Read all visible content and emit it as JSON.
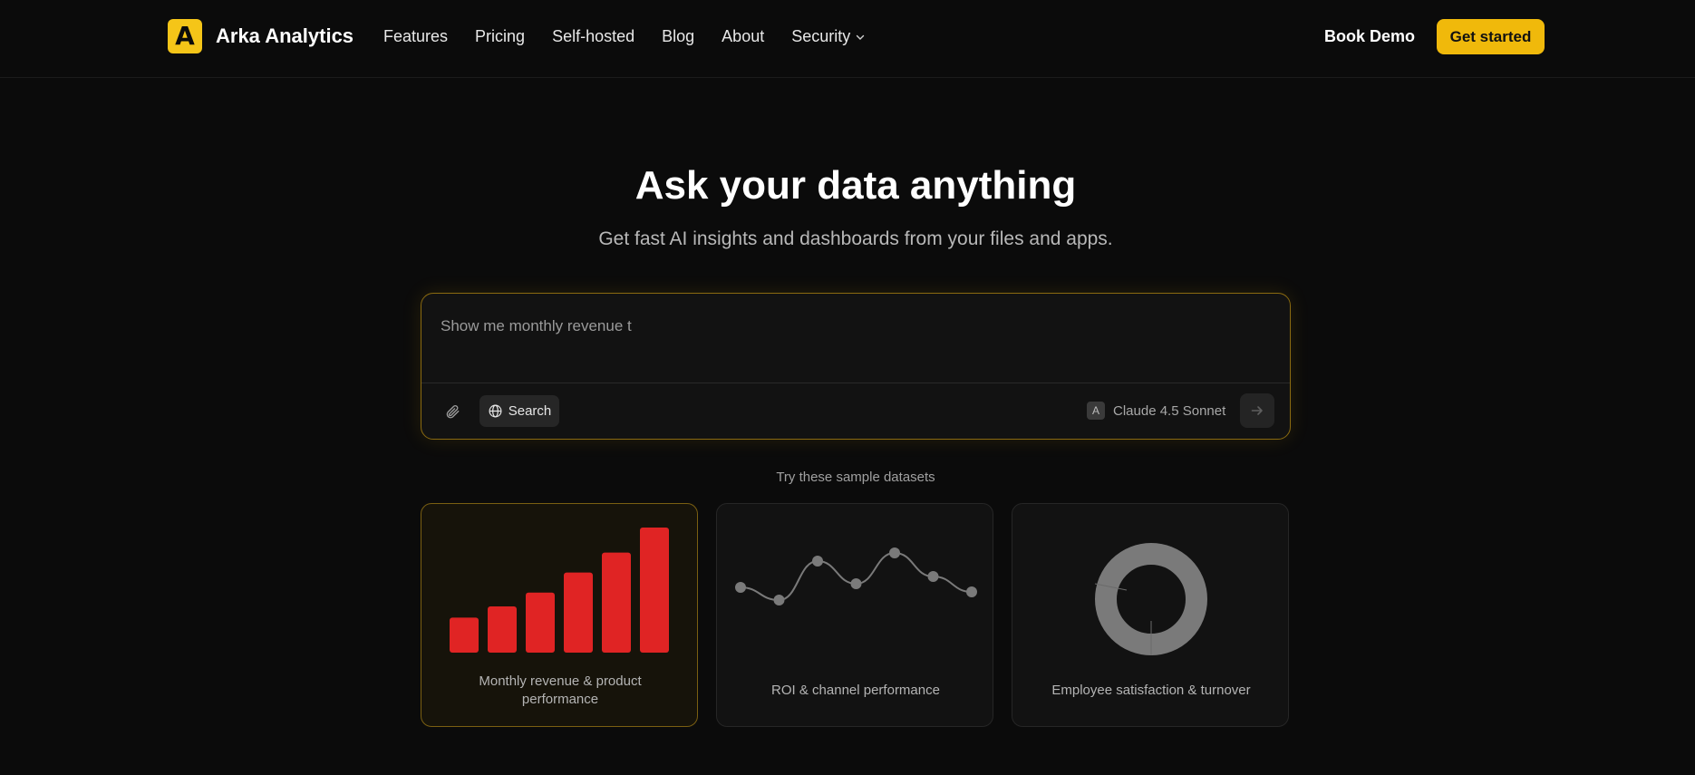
{
  "nav": {
    "logo_letter": "A",
    "brand": "Arka Analytics",
    "links": [
      "Features",
      "Pricing",
      "Self-hosted",
      "Blog",
      "About",
      "Security"
    ],
    "book_demo": "Book Demo",
    "get_started": "Get started"
  },
  "hero": {
    "title": "Ask your data anything",
    "subtitle": "Get fast AI insights and dashboards from your files and apps."
  },
  "prompt": {
    "value": "Show me monthly revenue t",
    "search_label": "Search",
    "model_badge": "A",
    "model_name": "Claude 4.5 Sonnet"
  },
  "samples": {
    "label": "Try these sample datasets",
    "cards": [
      {
        "label": "Monthly revenue & product performance",
        "bars": [
          0.28,
          0.37,
          0.48,
          0.64,
          0.8,
          1.0
        ],
        "bar_color": "#e02424"
      },
      {
        "label": "ROI & channel performance",
        "points": [
          0.38,
          0.24,
          0.67,
          0.42,
          0.76,
          0.5,
          0.33
        ]
      },
      {
        "label": "Employee satisfaction & turnover"
      }
    ]
  },
  "colors": {
    "accent": "#f0b90b",
    "bar": "#e02424",
    "line_gray": "#7a7a7a"
  }
}
